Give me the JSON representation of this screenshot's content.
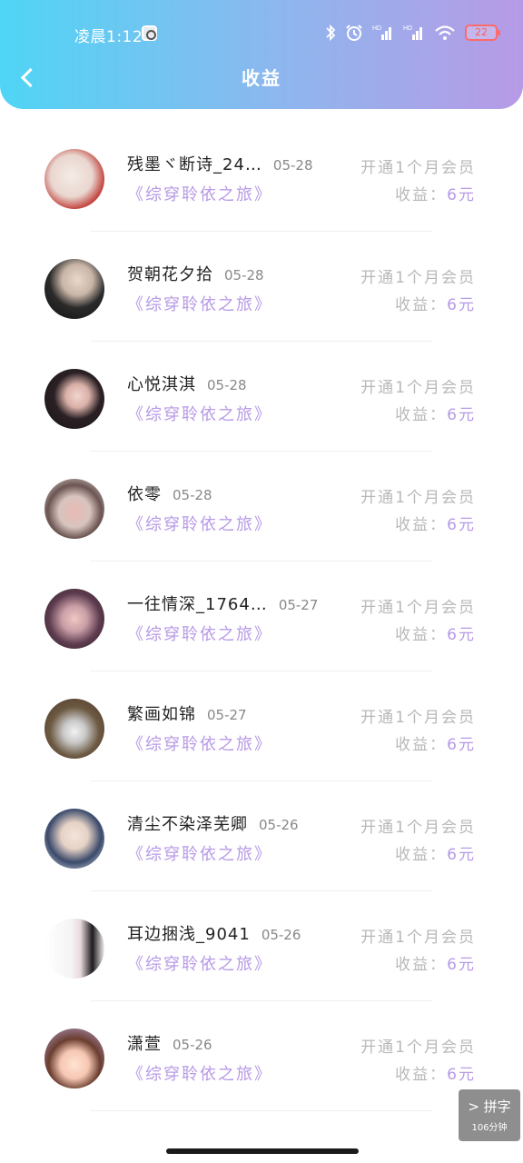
{
  "status_bar": {
    "time": "凌晨1:12",
    "battery": "22"
  },
  "header": {
    "title": "收益"
  },
  "rows": [
    {
      "name": "残墨ヾ断诗_24…",
      "date": "05-28",
      "book": "《综穿聆依之旅》",
      "vip": "开通1个月会员",
      "earn_label": "收益：",
      "earn_amount": "6元"
    },
    {
      "name": "贺朝花夕拾",
      "date": "05-28",
      "book": "《综穿聆依之旅》",
      "vip": "开通1个月会员",
      "earn_label": "收益：",
      "earn_amount": "6元"
    },
    {
      "name": "心悦淇淇",
      "date": "05-28",
      "book": "《综穿聆依之旅》",
      "vip": "开通1个月会员",
      "earn_label": "收益：",
      "earn_amount": "6元"
    },
    {
      "name": "依零",
      "date": "05-28",
      "book": "《综穿聆依之旅》",
      "vip": "开通1个月会员",
      "earn_label": "收益：",
      "earn_amount": "6元"
    },
    {
      "name": "一往情深_1764…",
      "date": "05-27",
      "book": "《综穿聆依之旅》",
      "vip": "开通1个月会员",
      "earn_label": "收益：",
      "earn_amount": "6元"
    },
    {
      "name": "繁画如锦",
      "date": "05-27",
      "book": "《综穿聆依之旅》",
      "vip": "开通1个月会员",
      "earn_label": "收益：",
      "earn_amount": "6元"
    },
    {
      "name": "清尘不染泽芜卿",
      "date": "05-26",
      "book": "《综穿聆依之旅》",
      "vip": "开通1个月会员",
      "earn_label": "收益：",
      "earn_amount": "6元"
    },
    {
      "name": "耳边捆浅_9041",
      "date": "05-26",
      "book": "《综穿聆依之旅》",
      "vip": "开通1个月会员",
      "earn_label": "收益：",
      "earn_amount": "6元"
    },
    {
      "name": "潇萱",
      "date": "05-26",
      "book": "《综穿聆依之旅》",
      "vip": "开通1个月会员",
      "earn_label": "收益：",
      "earn_amount": "6元"
    }
  ],
  "ime": {
    "label": "> 拼字",
    "sub": "106分钟"
  },
  "colors": {
    "accent": "#b79ae6",
    "header_start": "#4fd5f5",
    "header_end": "#b79ae6"
  }
}
